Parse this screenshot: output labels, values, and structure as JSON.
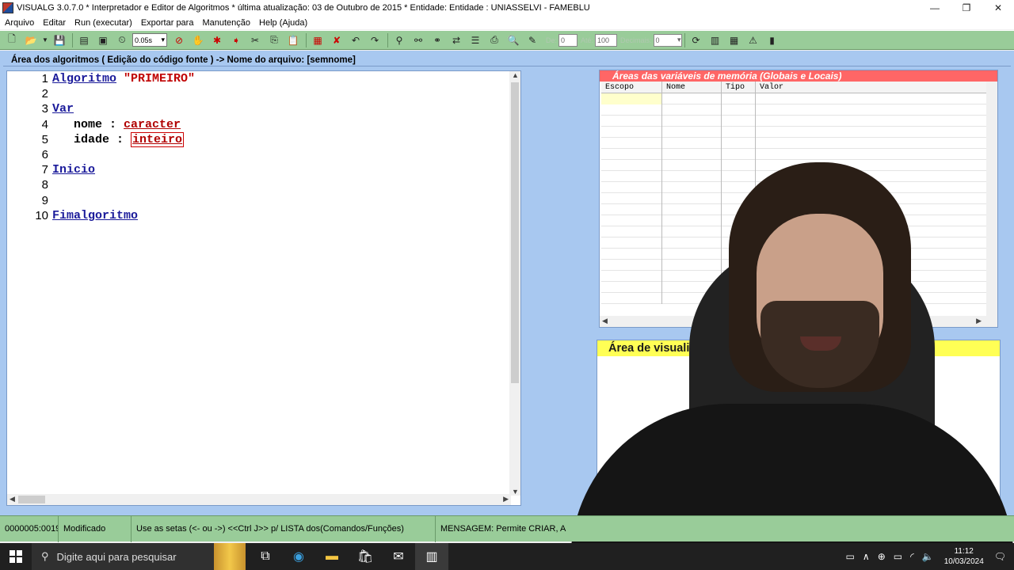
{
  "window": {
    "title": "VISUALG 3.0.7.0 * Interpretador e Editor de Algoritmos * última atualização: 03 de Outubro de 2015 * Entidade: Entidade : UNIASSELVI - FAMEBLU",
    "minimize": "—",
    "maximize": "❐",
    "close": "✕"
  },
  "menu": [
    "Arquivo",
    "Editar",
    "Run (executar)",
    "Exportar para",
    "Manutenção",
    "Help (Ajuda)"
  ],
  "toolbar": {
    "speed": "0.05s",
    "de_label": "De:",
    "de_value": "0",
    "ate_label": "Até:",
    "ate_value": "100",
    "decimais_label": "Decimais:",
    "decimais_value": "0"
  },
  "editor": {
    "header": "Área dos algoritmos ( Edição do código fonte ) -> Nome do arquivo: [semnome]",
    "lines": [
      {
        "n": "1",
        "kw": "Algoritmo",
        "rest": " \"PRIMEIRO\""
      },
      {
        "n": "2"
      },
      {
        "n": "3",
        "kw": "Var"
      },
      {
        "n": "4",
        "indent": "   ",
        "id": "nome",
        "sep": " : ",
        "ty": "caracter"
      },
      {
        "n": "5",
        "indent": "   ",
        "id": "idade",
        "sep": " : ",
        "ty": "inteiro"
      },
      {
        "n": "6"
      },
      {
        "n": "7",
        "kw": "Inicio"
      },
      {
        "n": "8"
      },
      {
        "n": "9"
      },
      {
        "n": "10",
        "kw": "Fimalgoritmo"
      }
    ]
  },
  "vars_panel": {
    "title": "Áreas das variáveis de memória (Globais e Locais)",
    "columns": [
      "Escopo",
      "Nome",
      "Tipo",
      "Valor"
    ]
  },
  "vis_panel": {
    "title": "Área de visualiz"
  },
  "status": {
    "position": "0000005:0019",
    "state": "Modificado",
    "hint": "Use as setas (<- ou ->) <<Ctrl J>> p/ LISTA dos(Comandos/Funções)",
    "message": "MENSAGEM: Permite CRIAR, A"
  },
  "taskbar": {
    "search_placeholder": "Digite aqui para pesquisar",
    "time": "11:12",
    "date": "10/03/2024"
  }
}
